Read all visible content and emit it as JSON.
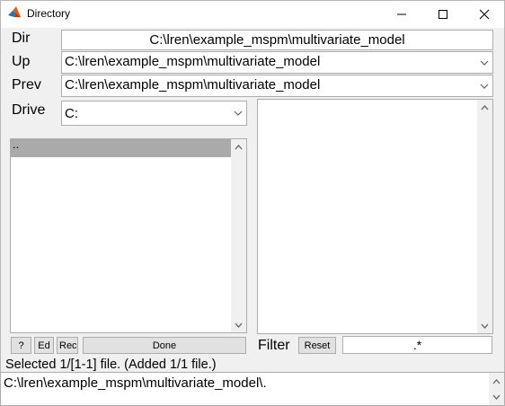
{
  "window": {
    "title": "Directory",
    "icon": "matlab-icon",
    "controls": {
      "minimize": "—",
      "maximize": "☐",
      "close": "✕"
    }
  },
  "dir": {
    "label": "Dir",
    "value": "C:\\lren\\example_mspm\\multivariate_model"
  },
  "up": {
    "label": "Up",
    "value": "C:\\lren\\example_mspm\\multivariate_model"
  },
  "prev": {
    "label": "Prev",
    "value": "C:\\lren\\example_mspm\\multivariate_model"
  },
  "drive": {
    "label": "Drive",
    "value": "C:"
  },
  "dir_list": {
    "items": [
      ".."
    ]
  },
  "buttons": {
    "help": "?",
    "edit": "Ed",
    "rec": "Rec",
    "done": "Done",
    "reset": "Reset"
  },
  "filter": {
    "label": "Filter",
    "value": ".*"
  },
  "status": "Selected 1/[1-1] file. (Added 1/1 file.)",
  "selection": {
    "value": "C:\\lren\\example_mspm\\multivariate_model\\."
  }
}
